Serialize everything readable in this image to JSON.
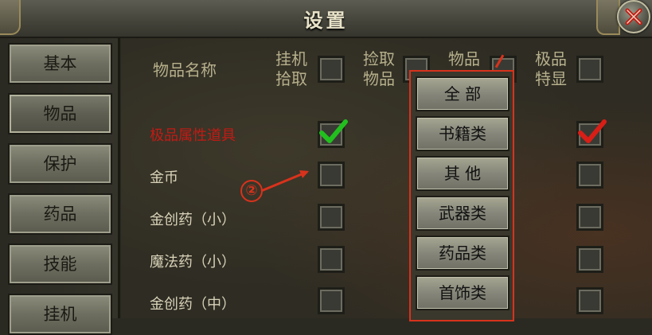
{
  "window": {
    "title": "设置"
  },
  "sidebar": {
    "items": [
      {
        "label": "基本",
        "active": false
      },
      {
        "label": "物品",
        "active": true
      },
      {
        "label": "保护",
        "active": false
      },
      {
        "label": "药品",
        "active": false
      },
      {
        "label": "技能",
        "active": false
      },
      {
        "label": "挂机",
        "active": false
      }
    ]
  },
  "table": {
    "headers": {
      "item_name": "物品名称",
      "auto_pickup": "挂机\n拾取",
      "pickup_item": "捡取\n物品",
      "item_type": "物品",
      "highlight": "极品\n特显"
    },
    "rows": [
      {
        "name": "极品属性道具",
        "special": true,
        "auto_pickup": true,
        "highlight": true
      },
      {
        "name": "金币",
        "special": false,
        "auto_pickup": false,
        "highlight": false
      },
      {
        "name": "金创药（小）",
        "special": false,
        "auto_pickup": false,
        "highlight": false
      },
      {
        "name": "魔法药（小）",
        "special": false,
        "auto_pickup": false,
        "highlight": false
      },
      {
        "name": "金创药（中）",
        "special": false,
        "auto_pickup": false,
        "highlight": false
      }
    ]
  },
  "dropdown": {
    "options": [
      "全 部",
      "书籍类",
      "其 他",
      "武器类",
      "药品类",
      "首饰类"
    ]
  },
  "annotation": {
    "marker": "②"
  },
  "colors": {
    "special_text": "#c41a14",
    "green_check": "#22c01e",
    "red_check": "#d81e16",
    "annotation": "#d8321c"
  }
}
